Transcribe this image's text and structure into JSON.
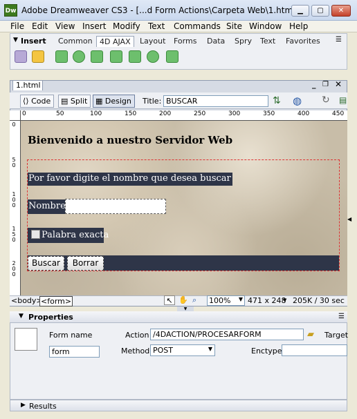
{
  "window": {
    "app_icon": "Dw",
    "title": "Adobe Dreamweaver CS3 - [...d Form Actions\\Carpeta Web\\1.html]"
  },
  "menu": [
    "File",
    "Edit",
    "View",
    "Insert",
    "Modify",
    "Text",
    "Commands",
    "Site",
    "Window",
    "Help"
  ],
  "insert_bar": {
    "label": "Insert",
    "tabs": [
      "Common",
      "4D AJAX",
      "Layout",
      "Forms",
      "Data",
      "Spry",
      "Text",
      "Favorites"
    ],
    "active_tab": "4D AJAX"
  },
  "document": {
    "tab": "1.html",
    "views": [
      "Code",
      "Split",
      "Design"
    ],
    "active_view": "Design",
    "title_label": "Title:",
    "title_value": "BUSCAR",
    "ruler_ticks": [
      "0",
      "50",
      "100",
      "150",
      "200",
      "250",
      "300",
      "350",
      "400",
      "450"
    ],
    "vruler_ticks": [
      "0",
      "5\n0",
      "1\n0\n0",
      "1\n5\n0",
      "2\n0\n0"
    ]
  },
  "page": {
    "heading": "Bienvenido a nuestro Servidor Web",
    "prompt": "Por favor digite el nombre que desea buscar",
    "nombre_label": "Nombre",
    "nombre_value": "",
    "exact_label": "Palabra exacta",
    "search_button": "Buscar",
    "clear_button": "Borrar"
  },
  "status": {
    "tag_body": "<body>",
    "tag_form": "<form>",
    "zoom": "100%",
    "size": "471 x 248",
    "download": "205K / 30 sec"
  },
  "properties": {
    "header": "Properties",
    "form_name_label": "Form name",
    "form_name_value": "form",
    "action_label": "Action",
    "action_value": "/4DACTION/PROCESARFORM",
    "target_label": "Target",
    "method_label": "Method",
    "method_value": "POST",
    "enctype_label": "Enctype",
    "enctype_value": ""
  },
  "results_panel": "Results",
  "colors": {
    "form_bar": "#2e3548",
    "form_outline": "#dd3333",
    "app_icon": "#3d7a1f"
  }
}
